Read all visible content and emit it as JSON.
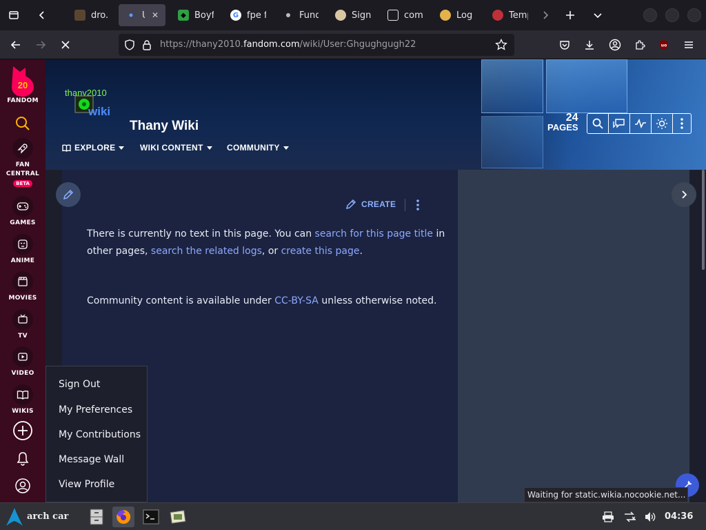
{
  "browser": {
    "tabs": [
      {
        "label": "dro.p",
        "active": false
      },
      {
        "label": "Us",
        "active": true
      },
      {
        "label": "Boyfr",
        "active": false
      },
      {
        "label": "fpe fr",
        "active": false
      },
      {
        "label": "Fund",
        "active": false
      },
      {
        "label": "Sign",
        "active": false
      },
      {
        "label": "comi",
        "active": false
      },
      {
        "label": "Log",
        "active": false
      },
      {
        "label": "Temp",
        "active": false
      }
    ],
    "url": {
      "prefix": "https://thany2010.",
      "host": "fandom.com",
      "path": "/wiki/User:Ghgughgugh22"
    }
  },
  "rail": {
    "brand_number": "20",
    "brand_label": "FANDOM",
    "items": [
      {
        "label": "FAN CENTRAL",
        "badge": "BETA",
        "icon": "rocket-icon"
      },
      {
        "label": "GAMES",
        "icon": "gamepad-icon"
      },
      {
        "label": "ANIME",
        "icon": "anime-face-icon"
      },
      {
        "label": "MOVIES",
        "icon": "clapperboard-icon"
      },
      {
        "label": "TV",
        "icon": "tv-icon"
      },
      {
        "label": "VIDEO",
        "icon": "video-play-icon"
      },
      {
        "label": "WIKIS",
        "icon": "book-icon"
      }
    ]
  },
  "wiki": {
    "logo_text_top": "thany2010",
    "logo_text_wiki": "wiki",
    "title": "Thany Wiki",
    "nav": [
      {
        "label": "EXPLORE"
      },
      {
        "label": "WIKI CONTENT"
      },
      {
        "label": "COMMUNITY"
      }
    ],
    "pages_count": "24",
    "pages_label": "PAGES"
  },
  "content": {
    "create_label": "CREATE",
    "para1_a": "There is currently no text in this page. You can ",
    "para1_link1": "search for this page title",
    "para1_b": " in",
    "para1_c": "other pages, ",
    "para1_link2": "search the related logs",
    "para1_d": ", or ",
    "para1_link3": "create this page",
    "para1_e": ".",
    "para2_a": "Community content is available under ",
    "para2_link": "CC-BY-SA",
    "para2_b": " unless otherwise noted."
  },
  "user_menu": {
    "items": [
      "Sign Out",
      "My Preferences",
      "My Contributions",
      "Message Wall",
      "View Profile"
    ]
  },
  "status": {
    "loading_text": "Waiting for static.wikia.nocookie.net..."
  },
  "taskbar": {
    "start_label": "arch car",
    "clock": "04:36"
  },
  "colors": {
    "fandom_pink": "#fa005a",
    "link_blue": "#8fa8ff",
    "rail_bg": "#3a0a1e",
    "content_bg": "#1b2340"
  }
}
